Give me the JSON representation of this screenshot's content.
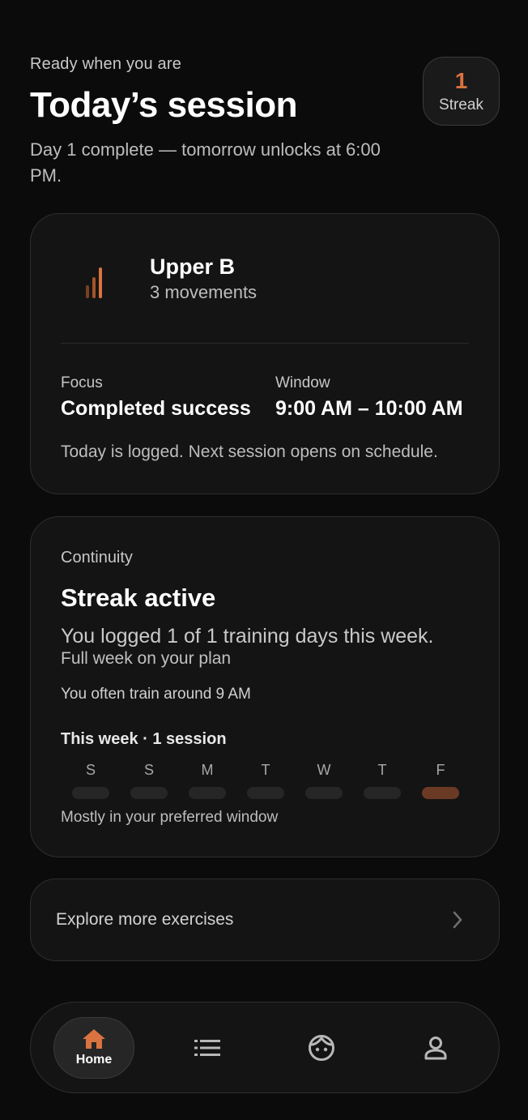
{
  "header": {
    "eyebrow": "Ready when you are",
    "title": "Today’s session",
    "subtitle": "Day 1 complete — tomorrow unlocks at 6:00 PM."
  },
  "streak": {
    "count": "1",
    "label": "Streak"
  },
  "session": {
    "icon": "signal-bars-icon",
    "name": "Upper B",
    "movements": "3 movements",
    "focus_label": "Focus",
    "focus_value": "Completed success",
    "window_label": "Window",
    "window_value": "9:00 AM – 10:00 AM",
    "note": "Today is logged. Next session opens on schedule."
  },
  "continuity": {
    "eyebrow": "Continuity",
    "title": "Streak active",
    "line1": "You logged 1 of 1 training days this week.",
    "line2": "Full week on your plan",
    "line3": "You often train around 9 AM",
    "week_label": "This week · 1 session",
    "days": [
      {
        "letter": "S",
        "active": false
      },
      {
        "letter": "S",
        "active": false
      },
      {
        "letter": "M",
        "active": false
      },
      {
        "letter": "T",
        "active": false
      },
      {
        "letter": "W",
        "active": false
      },
      {
        "letter": "T",
        "active": false
      },
      {
        "letter": "F",
        "active": true
      }
    ],
    "footer": "Mostly in your preferred window"
  },
  "explore": {
    "label": "Explore more exercises",
    "icon": "chevron-right-icon"
  },
  "nav": {
    "home_label": "Home",
    "items": [
      "home-icon",
      "list-icon",
      "face-icon",
      "person-icon"
    ]
  },
  "colors": {
    "accent": "#d9733f",
    "active_bar": "#6b3a24",
    "background": "#0b0b0b",
    "card": "#141414"
  }
}
